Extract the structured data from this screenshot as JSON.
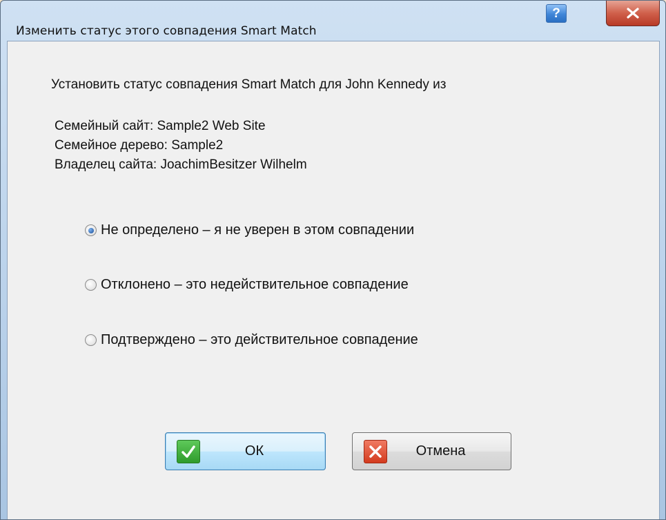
{
  "window": {
    "title": "Изменить статус этого совпадения Smart Match",
    "help_glyph": "?",
    "close_glyph": "x"
  },
  "dialog": {
    "prompt": "Установить статус совпадения Smart Match для John Kennedy из",
    "site_line": "Семейный сайт: Sample2 Web Site",
    "tree_line": "Семейное дерево: Sample2",
    "owner_line": "Владелец сайта: JoachimBesitzer Wilhelm"
  },
  "options": [
    {
      "label": "Не определено – я не уверен в этом совпадении",
      "selected": true
    },
    {
      "label": "Отклонено – это недействительное совпадение",
      "selected": false
    },
    {
      "label": "Подтверждено – это действительное совпадение",
      "selected": false
    }
  ],
  "buttons": {
    "ok_label": "ОК",
    "cancel_label": "Отмена"
  },
  "colors": {
    "ok_icon": "#2f9b2c",
    "cancel_icon": "#d33b1f",
    "close_button": "#c94a34",
    "help_button": "#3f86d8"
  }
}
